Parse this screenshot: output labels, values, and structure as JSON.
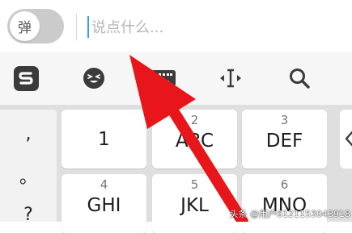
{
  "input_bar": {
    "danmu_toggle_label": "弹",
    "comment_placeholder": "说点什么..."
  },
  "toolbar": {
    "icons": [
      "sogou-logo-icon",
      "emoji-icon",
      "keyboard-icon",
      "cursor-move-icon",
      "search-icon"
    ]
  },
  "keyboard": {
    "symbols": [
      ",",
      "。",
      "?"
    ],
    "keys": [
      {
        "number": "",
        "letters": "1"
      },
      {
        "number": "2",
        "letters": "ABC"
      },
      {
        "number": "3",
        "letters": "DEF"
      },
      {
        "number": "4",
        "letters": "GHI"
      },
      {
        "number": "5",
        "letters": "JKL"
      },
      {
        "number": "6",
        "letters": "MNO"
      }
    ]
  },
  "watermark": "头条 @用户6121153043918",
  "colors": {
    "arrow": "#e8161b",
    "caret": "#3aa3d9",
    "toggle_bg": "#cbcbcb",
    "keyboard_bg": "#dfdfdf"
  }
}
